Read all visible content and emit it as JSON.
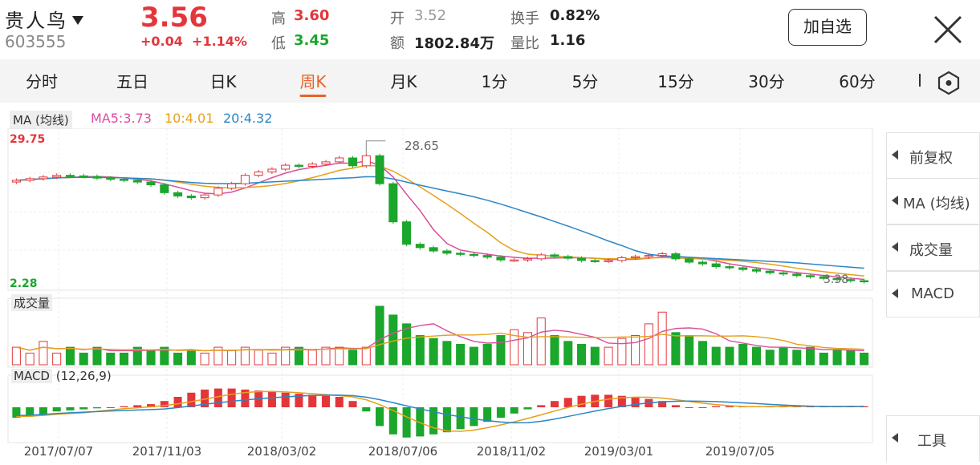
{
  "header": {
    "stock_name": "贵人鸟",
    "stock_code": "603555",
    "price": "3.56",
    "change": "+0.04",
    "change_pct": "+1.14%",
    "high_label": "高",
    "high_value": "3.60",
    "low_label": "低",
    "low_value": "3.45",
    "open_label": "开",
    "open_value": "3.52",
    "amount_label": "额",
    "amount_value": "1802.84万",
    "turnover_label": "换手",
    "turnover_value": "0.82%",
    "volratio_label": "量比",
    "volratio_value": "1.16",
    "add_watchlist_label": "加自选"
  },
  "tabs": [
    {
      "label": "分时",
      "active": false
    },
    {
      "label": "五日",
      "active": false
    },
    {
      "label": "日K",
      "active": false
    },
    {
      "label": "周K",
      "active": true
    },
    {
      "label": "月K",
      "active": false
    },
    {
      "label": "1分",
      "active": false
    },
    {
      "label": "5分",
      "active": false
    },
    {
      "label": "15分",
      "active": false
    },
    {
      "label": "30分",
      "active": false
    },
    {
      "label": "60分",
      "active": false
    }
  ],
  "ma_legend": {
    "tag": "MA (均线)",
    "ma5": "MA5:3.73",
    "ma10": "10:4.01",
    "ma20": "20:4.32"
  },
  "price_axis": {
    "max_label": "29.75",
    "min_label": "2.28",
    "peak_label": "28.65",
    "last_low_label": "3.38"
  },
  "volume_tag": "成交量",
  "macd_tag": "MACD",
  "macd_params": "(12,26,9)",
  "side_buttons": [
    "前复权",
    "MA (均线)",
    "成交量",
    "MACD",
    "工具"
  ],
  "dates": [
    "2017/07/07",
    "2017/11/03",
    "2018/03/02",
    "2018/07/06",
    "2018/11/02",
    "2019/03/01",
    "2019/07/05"
  ],
  "colors": {
    "up": "#e3363b",
    "down": "#1ba62c",
    "ma5": "#d94f9c",
    "ma10": "#e6a11a",
    "ma20": "#2a86c6",
    "accent": "#e8632d"
  },
  "icons": {
    "dropdown": "triangle-down-icon",
    "close": "close-icon",
    "settings": "hexagon-settings-icon",
    "side_arrow": "triangle-left-icon"
  },
  "chart_data": {
    "type": "candlestick",
    "title": "",
    "price_range": [
      2.28,
      29.75
    ],
    "x_dates": [
      "2017/07/07",
      "2017/11/03",
      "2018/03/02",
      "2018/07/06",
      "2018/11/02",
      "2019/03/01",
      "2019/07/05"
    ],
    "weekly_close": [
      21.6,
      21.9,
      22.2,
      22.5,
      22.4,
      22.3,
      22.0,
      21.8,
      21.6,
      21.3,
      20.8,
      19.4,
      18.8,
      18.5,
      19.0,
      20.2,
      21.0,
      22.5,
      23.1,
      23.6,
      24.3,
      24.1,
      24.5,
      24.9,
      25.6,
      24.2,
      26.0,
      21.0,
      14.2,
      10.2,
      9.6,
      9.0,
      8.6,
      8.4,
      8.2,
      7.9,
      7.4,
      7.4,
      7.6,
      8.3,
      8.0,
      7.7,
      7.3,
      7.2,
      7.3,
      7.8,
      8.0,
      8.2,
      8.5,
      7.6,
      7.0,
      6.7,
      6.2,
      6.0,
      5.7,
      5.4,
      5.1,
      4.9,
      4.6,
      4.4,
      4.1,
      3.9,
      3.7,
      3.56
    ],
    "ma5_last": 3.73,
    "ma10_last": 4.01,
    "ma20_last": 4.32,
    "volume_relative": [
      0.3,
      0.2,
      0.4,
      0.2,
      0.3,
      0.2,
      0.3,
      0.2,
      0.2,
      0.3,
      0.25,
      0.3,
      0.2,
      0.25,
      0.2,
      0.3,
      0.25,
      0.3,
      0.25,
      0.2,
      0.3,
      0.3,
      0.25,
      0.3,
      0.3,
      0.25,
      0.3,
      1.0,
      0.85,
      0.7,
      0.5,
      0.45,
      0.4,
      0.35,
      0.3,
      0.35,
      0.5,
      0.6,
      0.55,
      0.8,
      0.5,
      0.4,
      0.35,
      0.3,
      0.3,
      0.45,
      0.5,
      0.7,
      0.9,
      0.55,
      0.5,
      0.4,
      0.3,
      0.3,
      0.35,
      0.3,
      0.25,
      0.3,
      0.25,
      0.3,
      0.2,
      0.25,
      0.25,
      0.2
    ],
    "macd_hist": [
      -0.5,
      -0.45,
      -0.35,
      -0.2,
      -0.15,
      -0.1,
      -0.05,
      0.0,
      0.05,
      0.1,
      0.15,
      0.3,
      0.5,
      0.7,
      0.85,
      0.9,
      0.9,
      0.85,
      0.8,
      0.75,
      0.7,
      0.65,
      0.6,
      0.55,
      0.5,
      0.3,
      -0.2,
      -0.9,
      -1.3,
      -1.45,
      -1.4,
      -1.3,
      -1.2,
      -1.05,
      -0.9,
      -0.7,
      -0.5,
      -0.3,
      -0.1,
      0.1,
      0.3,
      0.45,
      0.55,
      0.6,
      0.6,
      0.55,
      0.5,
      0.4,
      0.3,
      0.1,
      0.0,
      0.0,
      0.05,
      0.05,
      0.05,
      0.05,
      0.05,
      0.05,
      0.05,
      0.05,
      0.05,
      0.05,
      0.05,
      0.05
    ]
  }
}
